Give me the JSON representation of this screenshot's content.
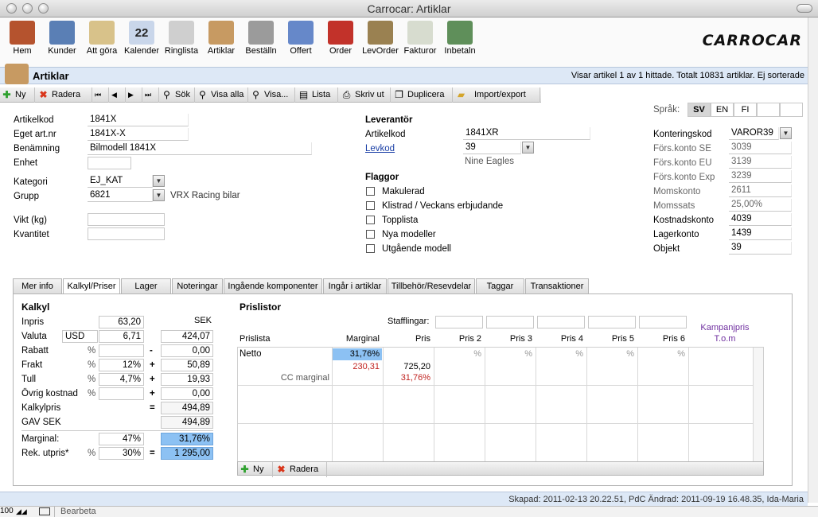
{
  "window": {
    "title": "Carrocar: Artiklar"
  },
  "toolbar": {
    "items": [
      {
        "label": "Hem",
        "icon": "house-icon",
        "color": "#b5532e"
      },
      {
        "label": "Kunder",
        "icon": "users-icon",
        "color": "#5a7fb5"
      },
      {
        "label": "Att göra",
        "icon": "notepad-icon",
        "color": "#d8c28a"
      },
      {
        "label": "Kalender",
        "icon": "calendar-icon",
        "color": "#c9d6ea",
        "text": "22"
      },
      {
        "label": "Ringlista",
        "icon": "phone-icon",
        "color": "#cfcfcf"
      },
      {
        "label": "Artiklar",
        "icon": "box-icon",
        "color": "#c79a62"
      },
      {
        "label": "Beställn",
        "icon": "fax-icon",
        "color": "#9b9b9b"
      },
      {
        "label": "Offert",
        "icon": "document-icon",
        "color": "#6688c9"
      },
      {
        "label": "Order",
        "icon": "book-icon",
        "color": "#c2322a"
      },
      {
        "label": "LevOrder",
        "icon": "delivery-icon",
        "color": "#9a8151"
      },
      {
        "label": "Fakturor",
        "icon": "invoice-icon",
        "color": "#d7dccf"
      },
      {
        "label": "Inbetaln",
        "icon": "money-icon",
        "color": "#5f8f5a"
      }
    ],
    "logo": "CARROCAR"
  },
  "header": {
    "title": "Artiklar",
    "info": "Visar artikel 1 av 1 hittade. Totalt 10831 artiklar. Ej sorterade"
  },
  "actions": {
    "new": "Ny",
    "delete": "Radera",
    "search": "Sök",
    "show_all": "Visa alla",
    "show": "Visa...",
    "list": "Lista",
    "print": "Skriv ut",
    "duplicate": "Duplicera",
    "import_export": "Import/export"
  },
  "article": {
    "artikelkod_label": "Artikelkod",
    "artikelkod": "1841X",
    "eget_label": "Eget art.nr",
    "eget": "1841X-X",
    "benamning_label": "Benämning",
    "benamning": "Bilmodell 1841X",
    "enhet_label": "Enhet",
    "enhet": "",
    "kategori_label": "Kategori",
    "kategori": "EJ_KAT",
    "grupp_label": "Grupp",
    "grupp": "6821",
    "grupp_desc": "VRX Racing bilar",
    "vikt_label": "Vikt (kg)",
    "vikt": "",
    "kvantitet_label": "Kvantitet",
    "kvantitet": ""
  },
  "supplier": {
    "heading": "Leverantör",
    "artikelkod_label": "Artikelkod",
    "artikelkod": "1841XR",
    "levkod_label": "Levkod",
    "levkod": "39",
    "name": "Nine Eagles"
  },
  "flags": {
    "heading": "Flaggor",
    "items": [
      "Makulerad",
      "Klistrad / Veckans erbjudande",
      "Topplista",
      "Nya modeller",
      "Utgående modell"
    ]
  },
  "language": {
    "label": "Språk:",
    "options": [
      "SV",
      "EN",
      "FI"
    ],
    "selected": "SV"
  },
  "accounts": {
    "konteringskod_label": "Konteringskod",
    "konteringskod": "VAROR39",
    "se_label": "Förs.konto SE",
    "se": "3039",
    "eu_label": "Förs.konto EU",
    "eu": "3139",
    "exp_label": "Förs.konto Exp",
    "exp": "3239",
    "moms_label": "Momskonto",
    "moms": "2611",
    "momssats_label": "Momssats",
    "momssats": "25,00%",
    "kostnad_label": "Kostnadskonto",
    "kostnad": "4039",
    "lager_label": "Lagerkonto",
    "lager": "1439",
    "objekt_label": "Objekt",
    "objekt": "39"
  },
  "tabs": [
    "Mer info",
    "Kalkyl/Priser",
    "Lager",
    "Noteringar",
    "Ingående komponenter",
    "Ingår i artiklar",
    "Tillbehör/Resevdelar",
    "Taggar",
    "Transaktioner"
  ],
  "kalkyl": {
    "heading": "Kalkyl",
    "sek": "SEK",
    "inpris_label": "Inpris",
    "inpris": "63,20",
    "valuta_label": "Valuta",
    "valuta_code": "USD",
    "valuta_rate": "6,71",
    "valuta_sek": "424,07",
    "rabatt_label": "Rabatt",
    "rabatt_pct": "",
    "rabatt_op": "-",
    "rabatt_sek": "0,00",
    "frakt_label": "Frakt",
    "frakt_pct": "12%",
    "frakt_op": "+",
    "frakt_sek": "50,89",
    "tull_label": "Tull",
    "tull_pct": "4,7%",
    "tull_op": "+",
    "tull_sek": "19,93",
    "ovrig_label": "Övrig kostnad",
    "ovrig_pct": "",
    "ovrig_op": "+",
    "ovrig_sek": "0,00",
    "kalkylpris_label": "Kalkylpris",
    "kalkylpris_op": "=",
    "kalkylpris": "494,89",
    "gav_label": "GAV SEK",
    "gav": "494,89",
    "marginal_label": "Marginal:",
    "marginal_pct": "47%",
    "marginal_res": "31,76%",
    "rek_label": "Rek. utpris*",
    "rek_pct": "30%",
    "rek_op": "=",
    "rek": "1 295,00",
    "pct": "%"
  },
  "prislistor": {
    "heading": "Prislistor",
    "stafflingar": "Stafflingar:",
    "columns": [
      "Prislista",
      "Marginal",
      "Pris",
      "Pris 2",
      "Pris 3",
      "Pris 4",
      "Pris 5",
      "Pris 6"
    ],
    "kampanj": "Kampanjpris",
    "tom": "T.o.m",
    "row_name": "Netto",
    "row_marginal": "31,76%",
    "row_marginal2": "230,31",
    "row_pris": "725,20",
    "row_pris2": "31,76%",
    "cc_label": "CC marginal",
    "pct": "%",
    "new": "Ny",
    "delete": "Radera"
  },
  "status": {
    "text": "Skapad: 2011-02-13 20.22.51, PdC Ändrad: 2011-09-19 16.48.35, Ida-Maria"
  },
  "bottom": {
    "zoom": "100",
    "mode": "Bearbeta"
  }
}
